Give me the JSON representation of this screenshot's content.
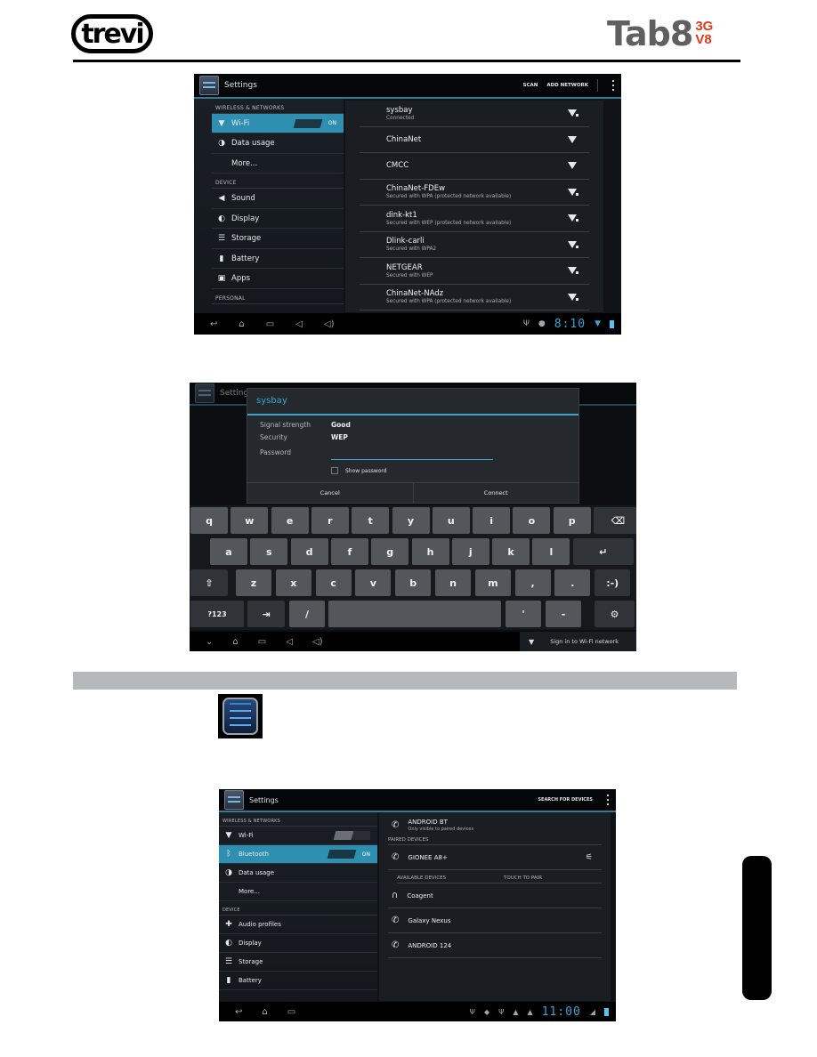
{
  "header": {
    "brand_logo": "trevi",
    "product_logo_main": "Tab8",
    "product_logo_sup_top": "3G",
    "product_logo_sup_bottom": "V8",
    "accent_color": "#e23a1a"
  },
  "screen1": {
    "app_title": "Settings",
    "actions": [
      "SCAN",
      "ADD NETWORK"
    ],
    "left_menu": [
      {
        "type": "category",
        "label": "WIRELESS & NETWORKS"
      },
      {
        "type": "item",
        "label": "Wi-Fi",
        "icon": "wifi-icon",
        "selected": true,
        "toggle": "ON"
      },
      {
        "type": "item",
        "label": "Data usage",
        "icon": "data-usage-icon"
      },
      {
        "type": "item",
        "label": "More...",
        "icon": ""
      },
      {
        "type": "category",
        "label": "DEVICE"
      },
      {
        "type": "item",
        "label": "Sound",
        "icon": "sound-icon"
      },
      {
        "type": "item",
        "label": "Display",
        "icon": "display-icon"
      },
      {
        "type": "item",
        "label": "Storage",
        "icon": "storage-icon"
      },
      {
        "type": "item",
        "label": "Battery",
        "icon": "battery-icon"
      },
      {
        "type": "item",
        "label": "Apps",
        "icon": "apps-icon"
      },
      {
        "type": "category",
        "label": "PERSONAL"
      }
    ],
    "networks": [
      {
        "name": "sysbay",
        "status": "Connected",
        "secured": true
      },
      {
        "name": "ChinaNet",
        "status": "",
        "secured": false
      },
      {
        "name": "CMCC",
        "status": "",
        "secured": false
      },
      {
        "name": "ChinaNet-FDEw",
        "status": "Secured with WPA (protected network available)",
        "secured": true
      },
      {
        "name": "dink-kt1",
        "status": "Secured with WEP (protected network available)",
        "secured": true
      },
      {
        "name": "Dlink-carli",
        "status": "Secured with WPA2",
        "secured": true
      },
      {
        "name": "NETGEAR",
        "status": "Secured with WEP",
        "secured": true
      },
      {
        "name": "ChinaNet-NAdz",
        "status": "Secured with WPA (protected network available)",
        "secured": true
      }
    ],
    "clock": "8:10",
    "accent_color": "#2f8fb1"
  },
  "screen2": {
    "bg_app_title": "Settings",
    "dialog": {
      "title": "sysbay",
      "rows": [
        {
          "key": "Signal strength",
          "value": "Good"
        },
        {
          "key": "Security",
          "value": "WEP"
        }
      ],
      "password_label": "Password",
      "password_value": "",
      "show_password_label": "Show password",
      "show_password_checked": false,
      "cancel_label": "Cancel",
      "connect_label": "Connect"
    },
    "keyboard": {
      "row1": [
        "q",
        "w",
        "e",
        "r",
        "t",
        "y",
        "u",
        "i",
        "o",
        "p",
        "⌫"
      ],
      "row2": [
        "a",
        "s",
        "d",
        "f",
        "g",
        "h",
        "j",
        "k",
        "l",
        "↵"
      ],
      "row3": [
        "⇧",
        "z",
        "x",
        "c",
        "v",
        "b",
        "n",
        "m",
        ",",
        ".",
        ":-)"
      ],
      "row4": [
        "?123",
        "⇥",
        "/",
        " ",
        "'",
        "-",
        "⚙"
      ]
    },
    "notification": "Sign in to Wi-Fi network"
  },
  "section": {
    "heading": ""
  },
  "screen3": {
    "app_title": "Settings",
    "actions": [
      "SEARCH FOR DEVICES"
    ],
    "left_menu": [
      {
        "type": "category",
        "label": "WIRELESS & NETWORKS"
      },
      {
        "type": "item",
        "label": "Wi-Fi",
        "icon": "wifi-icon",
        "toggle": "OFF"
      },
      {
        "type": "item",
        "label": "Bluetooth",
        "icon": "bluetooth-icon",
        "selected": true,
        "toggle": "ON"
      },
      {
        "type": "item",
        "label": "Data usage",
        "icon": "data-usage-icon"
      },
      {
        "type": "item",
        "label": "More...",
        "icon": ""
      },
      {
        "type": "category",
        "label": "DEVICE"
      },
      {
        "type": "item",
        "label": "Audio profiles",
        "icon": "audio-profiles-icon"
      },
      {
        "type": "item",
        "label": "Display",
        "icon": "display-icon"
      },
      {
        "type": "item",
        "label": "Storage",
        "icon": "storage-icon"
      },
      {
        "type": "item",
        "label": "Battery",
        "icon": "battery-icon"
      }
    ],
    "this_device": {
      "name": "ANDROID BT",
      "status": "Only visible to paired devices"
    },
    "paired_header": "PAIRED DEVICES",
    "paired": [
      {
        "name": "GIONEE A8+"
      }
    ],
    "available_header": "AVAILABLE DEVICES",
    "touch_to_pair": "TOUCH TO PAIR",
    "available": [
      {
        "name": "Coagent",
        "icon": "headphones-icon"
      },
      {
        "name": "Galaxy Nexus",
        "icon": "phone-icon"
      },
      {
        "name": "ANDROID 124",
        "icon": "phone-icon"
      }
    ],
    "clock": "11:00"
  }
}
